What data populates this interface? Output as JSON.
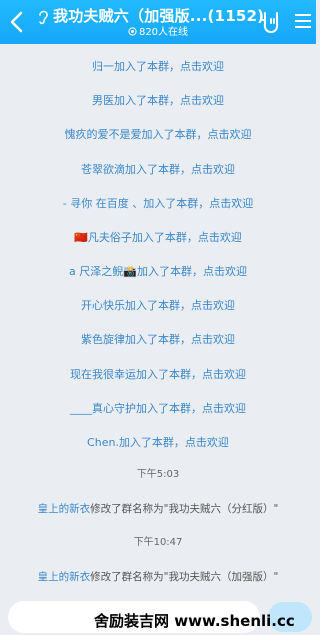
{
  "header": {
    "title": "我功夫贼六（加强版...(1152)",
    "online": "820人在线"
  },
  "messages": [
    {
      "name": "归一",
      "action": "加入了本群，",
      "link": "点击欢迎"
    },
    {
      "name": "男医",
      "action": "加入了本群，",
      "link": "点击欢迎"
    },
    {
      "name": "愧疚的爱不是爱",
      "action": "加入了本群，",
      "link": "点击欢迎"
    },
    {
      "name": "苍翠欲滴",
      "action": "加入了本群，",
      "link": "点击欢迎"
    },
    {
      "name": "- 寻你 在百度 、",
      "action": "加入了本群，",
      "link": "点击欢迎"
    },
    {
      "name": "🇨🇳凡夫俗子",
      "action": "加入了本群，",
      "link": "点击欢迎"
    },
    {
      "name": "a 尺泽之鲵📸",
      "action": "加入了本群，",
      "link": "点击欢迎"
    },
    {
      "name": "开心快乐",
      "action": "加入了本群，",
      "link": "点击欢迎"
    },
    {
      "name": "紫色旋律",
      "action": "加入了本群，",
      "link": "点击欢迎"
    },
    {
      "name": "现在我很幸运",
      "action": "加入了本群，",
      "link": "点击欢迎"
    },
    {
      "name": "____真心守护",
      "action": "加入了本群，",
      "link": "点击欢迎"
    },
    {
      "name": "Chen.",
      "action": "加入了本群，",
      "link": "点击欢迎"
    }
  ],
  "time1": "下午5:03",
  "sys1": {
    "name": "皇上的新衣",
    "text": "修改了群名称为\"我功夫贼六（分红版）\""
  },
  "time2": "下午10:47",
  "sys2": {
    "name": "皇上的新衣",
    "text": "修改了群名称为\"我功夫贼六（加强版）\""
  },
  "watermark": "舍励装吉网  www.shenli.cc",
  "colors": {
    "header": "#16a7f7",
    "link": "#3b87c9",
    "background": "#eaeef2"
  }
}
